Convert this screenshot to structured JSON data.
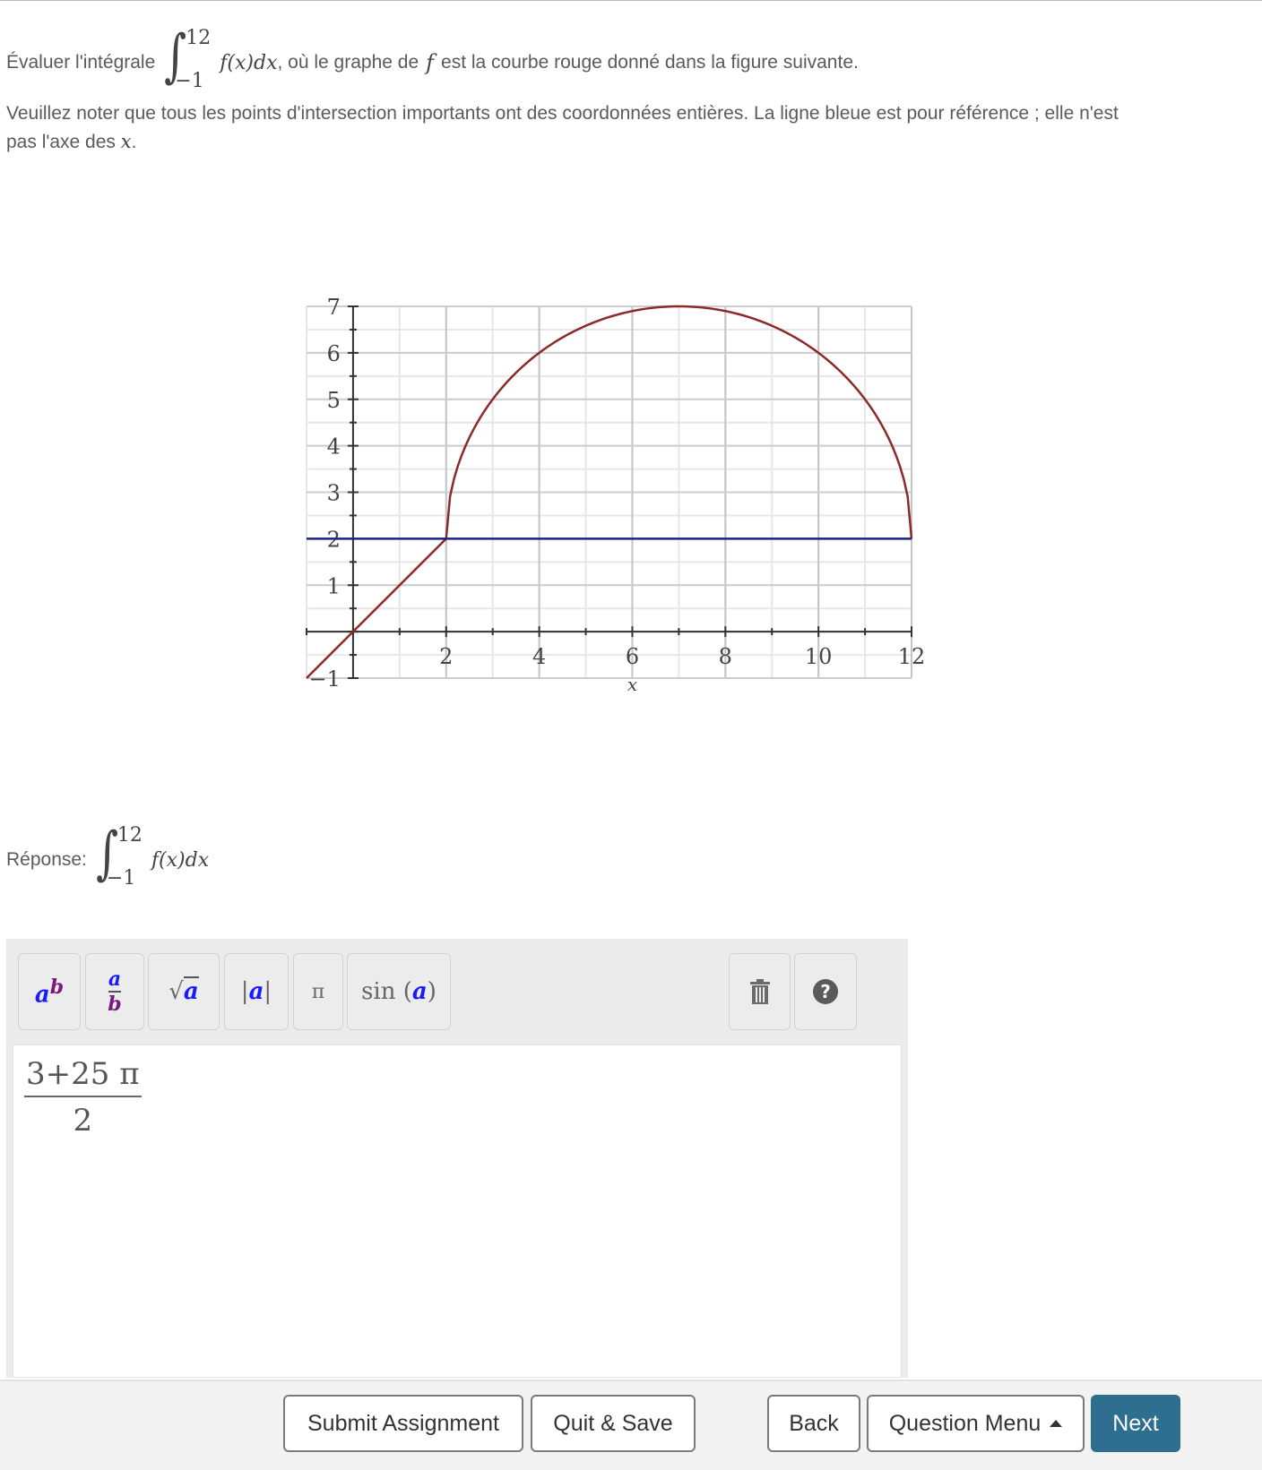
{
  "question": {
    "line1_prefix": "Évaluer l'intégrale",
    "integral_upper": "12",
    "integral_lower": "−1",
    "integrand": "f(x)dx",
    "line1_suffix_a": ", où le graphe de",
    "f_symbol": "f",
    "line1_suffix_b": "est la courbe rouge donné dans la figure suivante.",
    "line2": "Veuillez noter que tous les points d'intersection importants ont des coordonnées entières.  La ligne bleue est pour référence ; elle n'est",
    "line3_prefix": "pas l'axe des",
    "line3_var": "x",
    "line3_suffix": "."
  },
  "chart_data": {
    "type": "line",
    "title": "",
    "xlabel": "x",
    "ylabel": "",
    "xlim": [
      -1,
      12
    ],
    "ylim": [
      -1,
      7
    ],
    "x_ticks": [
      2,
      4,
      6,
      8,
      10,
      12
    ],
    "x_tick_labels": [
      "2",
      "4",
      "6",
      "8",
      "10",
      "12"
    ],
    "y_ticks": [
      -1,
      1,
      2,
      3,
      4,
      5,
      6,
      7
    ],
    "y_tick_labels": [
      "−1",
      "1",
      "2",
      "3",
      "4",
      "5",
      "6",
      "7"
    ],
    "grid": true,
    "series": [
      {
        "name": "f (red curve)",
        "color": "#8b2a2a",
        "segments": [
          {
            "kind": "line",
            "points": [
              [
                -1,
                -1
              ],
              [
                2,
                2
              ]
            ]
          },
          {
            "kind": "semicircle",
            "center": [
              7,
              2
            ],
            "radius": 5,
            "from_x": 2,
            "to_x": 12
          }
        ]
      },
      {
        "name": "reference line (blue)",
        "color": "#1a237e",
        "segments": [
          {
            "kind": "line",
            "points": [
              [
                -1,
                2
              ],
              [
                12,
                2
              ]
            ]
          }
        ]
      }
    ]
  },
  "answer": {
    "label": "Réponse:",
    "integral_upper": "12",
    "integral_lower": "−1",
    "integrand": "f(x)dx",
    "toolbar": [
      {
        "name": "power",
        "icon": "power-icon"
      },
      {
        "name": "fraction",
        "icon": "fraction-icon"
      },
      {
        "name": "sqrt",
        "icon": "sqrt-icon"
      },
      {
        "name": "abs",
        "icon": "abs-icon"
      },
      {
        "name": "pi",
        "label": "π"
      },
      {
        "name": "sin",
        "label": "sin"
      }
    ],
    "toolbar_labels": {
      "a": "a",
      "b": "b",
      "pi": "π",
      "sin": "sin"
    },
    "value_numerator": "3+25 π",
    "value_denominator": "2"
  },
  "footer": {
    "submit": "Submit Assignment",
    "quit": "Quit & Save",
    "back": "Back",
    "menu": "Question Menu",
    "next": "Next"
  }
}
